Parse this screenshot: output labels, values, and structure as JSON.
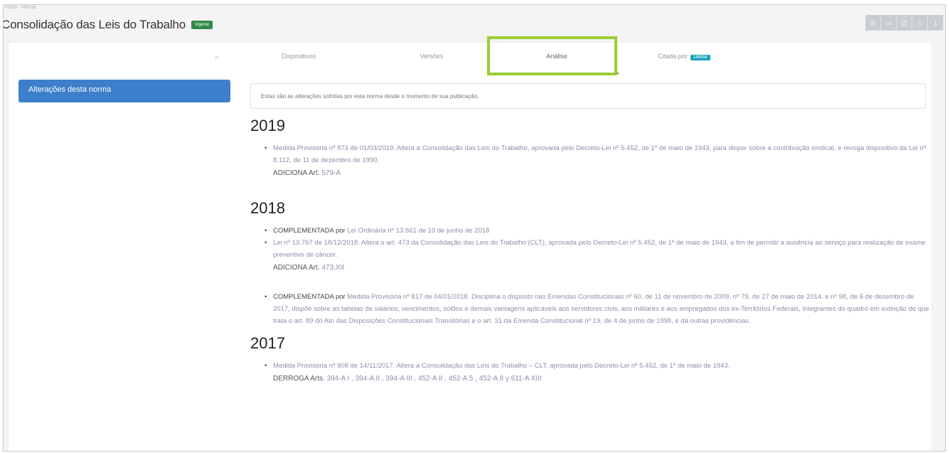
{
  "page": {
    "breadcrumb": "Início · Norma",
    "title": "Consolidação das Leis do Trabalho",
    "status_badge": "Vigente"
  },
  "toolbar": {
    "buttons": [
      "print-icon",
      "bookmark-icon",
      "share-icon",
      "star-icon",
      "download-icon"
    ]
  },
  "tabs": [
    {
      "label": "Dispositivos"
    },
    {
      "label": "Versões"
    },
    {
      "label": "Análise"
    },
    {
      "label": "Citada por",
      "badge": "148958"
    }
  ],
  "sidebar": {
    "active_item": "Alterações desta norma"
  },
  "info": {
    "text": "Estas são as alterações sofridas por esta norma desde o momento de sua publicação."
  },
  "years": [
    {
      "year": "2019",
      "entries": [
        {
          "label": "",
          "text": "Medida Provisória nº 873 de 01/03/2019. Altera a Consolidação das Leis do Trabalho, aprovada pelo Decreto-Lei nº 5.452, de 1º de maio de 1943, para dispor sobre a contribuição sindical, e revoga dispositivo da Lei nº 8.112, de 11 de dezembro de 1990.",
          "action": "ADICIONA Art.",
          "values": "579-A"
        }
      ]
    },
    {
      "year": "2018",
      "entries": [
        {
          "label": "COMPLEMENTADA por",
          "text": "Lei Ordinária nº 13.661 de 10 de junho de 2018"
        },
        {
          "label": "",
          "text": "Lei nº 13.767 de 18/12/2018. Altera o art. 473 da Consolidação das Leis do Trabalho (CLT), aprovada pelo Decreto-Lei nº 5.452, de 1º de maio de 1943, a fim de permitir a ausência ao serviço para realização de exame preventivo de câncer.",
          "action": "ADICIONA Art.",
          "values": "473,XII"
        },
        {
          "label": "COMPLEMENTADA por",
          "text": "Medida Provisória nº 817 de 04/01/2018. Disciplina o disposto nas Emendas Constitucionais nº 60, de 11 de novembro de 2009, nº 79, de 27 de maio de 2014, e nº 98, de 6 de dezembro de 2017, dispõe sobre as tabelas de salários, vencimentos, soldos e demais vantagens aplicáveis aos servidores civis, aos militares e aos empregados dos ex-Territórios Federais, integrantes do quadro em extinção de que trata o art. 89 do Ato das Disposições Constitucionais Transitórias e o art. 31 da Emenda Constitucional nº 19, de 4 de junho de 1998, e dá outras providências."
        }
      ]
    },
    {
      "year": "2017",
      "entries": [
        {
          "label": "",
          "text": "Medida Provisória nº 808 de 14/11/2017. Altera a Consolidação das Leis do Trabalho – CLT, aprovada pelo Decreto-Lei nº 5.452, de 1º de maio de 1943.",
          "action": "DERROGA Arts.",
          "values": "394-A I , 394-A II , 394-A III , 452-A II , 452-A 5 , 452-A 8 y 611-A XIII"
        }
      ]
    }
  ]
}
